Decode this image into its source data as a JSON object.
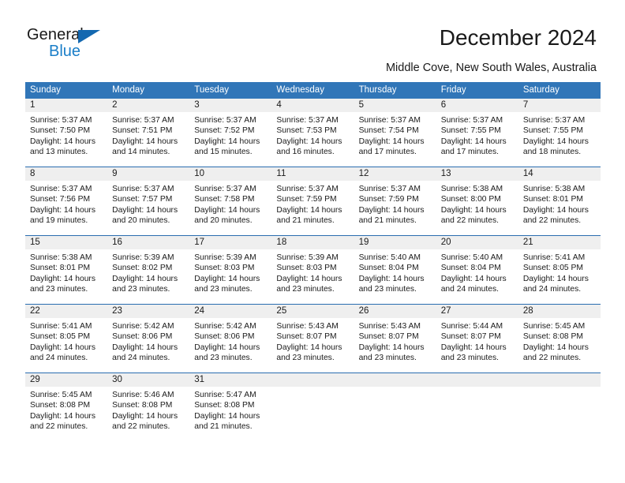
{
  "logo": {
    "word1": "General",
    "word2": "Blue",
    "triangle_color": "#1468b0",
    "blue_color": "#1a7ec8"
  },
  "header": {
    "title": "December 2024",
    "subtitle": "Middle Cove, New South Wales, Australia"
  },
  "theme": {
    "header_bg": "#3176b8",
    "week_divider": "#2a6db0",
    "day_band_bg": "#efefef",
    "text": "#1a1a1a"
  },
  "weekdays": [
    "Sunday",
    "Monday",
    "Tuesday",
    "Wednesday",
    "Thursday",
    "Friday",
    "Saturday"
  ],
  "labels": {
    "sunrise": "Sunrise:",
    "sunset": "Sunset:",
    "daylight": "Daylight:"
  },
  "weeks": [
    [
      {
        "day": "1",
        "sunrise": "Sunrise: 5:37 AM",
        "sunset": "Sunset: 7:50 PM",
        "daylight1": "Daylight: 14 hours",
        "daylight2": "and 13 minutes."
      },
      {
        "day": "2",
        "sunrise": "Sunrise: 5:37 AM",
        "sunset": "Sunset: 7:51 PM",
        "daylight1": "Daylight: 14 hours",
        "daylight2": "and 14 minutes."
      },
      {
        "day": "3",
        "sunrise": "Sunrise: 5:37 AM",
        "sunset": "Sunset: 7:52 PM",
        "daylight1": "Daylight: 14 hours",
        "daylight2": "and 15 minutes."
      },
      {
        "day": "4",
        "sunrise": "Sunrise: 5:37 AM",
        "sunset": "Sunset: 7:53 PM",
        "daylight1": "Daylight: 14 hours",
        "daylight2": "and 16 minutes."
      },
      {
        "day": "5",
        "sunrise": "Sunrise: 5:37 AM",
        "sunset": "Sunset: 7:54 PM",
        "daylight1": "Daylight: 14 hours",
        "daylight2": "and 17 minutes."
      },
      {
        "day": "6",
        "sunrise": "Sunrise: 5:37 AM",
        "sunset": "Sunset: 7:55 PM",
        "daylight1": "Daylight: 14 hours",
        "daylight2": "and 17 minutes."
      },
      {
        "day": "7",
        "sunrise": "Sunrise: 5:37 AM",
        "sunset": "Sunset: 7:55 PM",
        "daylight1": "Daylight: 14 hours",
        "daylight2": "and 18 minutes."
      }
    ],
    [
      {
        "day": "8",
        "sunrise": "Sunrise: 5:37 AM",
        "sunset": "Sunset: 7:56 PM",
        "daylight1": "Daylight: 14 hours",
        "daylight2": "and 19 minutes."
      },
      {
        "day": "9",
        "sunrise": "Sunrise: 5:37 AM",
        "sunset": "Sunset: 7:57 PM",
        "daylight1": "Daylight: 14 hours",
        "daylight2": "and 20 minutes."
      },
      {
        "day": "10",
        "sunrise": "Sunrise: 5:37 AM",
        "sunset": "Sunset: 7:58 PM",
        "daylight1": "Daylight: 14 hours",
        "daylight2": "and 20 minutes."
      },
      {
        "day": "11",
        "sunrise": "Sunrise: 5:37 AM",
        "sunset": "Sunset: 7:59 PM",
        "daylight1": "Daylight: 14 hours",
        "daylight2": "and 21 minutes."
      },
      {
        "day": "12",
        "sunrise": "Sunrise: 5:37 AM",
        "sunset": "Sunset: 7:59 PM",
        "daylight1": "Daylight: 14 hours",
        "daylight2": "and 21 minutes."
      },
      {
        "day": "13",
        "sunrise": "Sunrise: 5:38 AM",
        "sunset": "Sunset: 8:00 PM",
        "daylight1": "Daylight: 14 hours",
        "daylight2": "and 22 minutes."
      },
      {
        "day": "14",
        "sunrise": "Sunrise: 5:38 AM",
        "sunset": "Sunset: 8:01 PM",
        "daylight1": "Daylight: 14 hours",
        "daylight2": "and 22 minutes."
      }
    ],
    [
      {
        "day": "15",
        "sunrise": "Sunrise: 5:38 AM",
        "sunset": "Sunset: 8:01 PM",
        "daylight1": "Daylight: 14 hours",
        "daylight2": "and 23 minutes."
      },
      {
        "day": "16",
        "sunrise": "Sunrise: 5:39 AM",
        "sunset": "Sunset: 8:02 PM",
        "daylight1": "Daylight: 14 hours",
        "daylight2": "and 23 minutes."
      },
      {
        "day": "17",
        "sunrise": "Sunrise: 5:39 AM",
        "sunset": "Sunset: 8:03 PM",
        "daylight1": "Daylight: 14 hours",
        "daylight2": "and 23 minutes."
      },
      {
        "day": "18",
        "sunrise": "Sunrise: 5:39 AM",
        "sunset": "Sunset: 8:03 PM",
        "daylight1": "Daylight: 14 hours",
        "daylight2": "and 23 minutes."
      },
      {
        "day": "19",
        "sunrise": "Sunrise: 5:40 AM",
        "sunset": "Sunset: 8:04 PM",
        "daylight1": "Daylight: 14 hours",
        "daylight2": "and 23 minutes."
      },
      {
        "day": "20",
        "sunrise": "Sunrise: 5:40 AM",
        "sunset": "Sunset: 8:04 PM",
        "daylight1": "Daylight: 14 hours",
        "daylight2": "and 24 minutes."
      },
      {
        "day": "21",
        "sunrise": "Sunrise: 5:41 AM",
        "sunset": "Sunset: 8:05 PM",
        "daylight1": "Daylight: 14 hours",
        "daylight2": "and 24 minutes."
      }
    ],
    [
      {
        "day": "22",
        "sunrise": "Sunrise: 5:41 AM",
        "sunset": "Sunset: 8:05 PM",
        "daylight1": "Daylight: 14 hours",
        "daylight2": "and 24 minutes."
      },
      {
        "day": "23",
        "sunrise": "Sunrise: 5:42 AM",
        "sunset": "Sunset: 8:06 PM",
        "daylight1": "Daylight: 14 hours",
        "daylight2": "and 24 minutes."
      },
      {
        "day": "24",
        "sunrise": "Sunrise: 5:42 AM",
        "sunset": "Sunset: 8:06 PM",
        "daylight1": "Daylight: 14 hours",
        "daylight2": "and 23 minutes."
      },
      {
        "day": "25",
        "sunrise": "Sunrise: 5:43 AM",
        "sunset": "Sunset: 8:07 PM",
        "daylight1": "Daylight: 14 hours",
        "daylight2": "and 23 minutes."
      },
      {
        "day": "26",
        "sunrise": "Sunrise: 5:43 AM",
        "sunset": "Sunset: 8:07 PM",
        "daylight1": "Daylight: 14 hours",
        "daylight2": "and 23 minutes."
      },
      {
        "day": "27",
        "sunrise": "Sunrise: 5:44 AM",
        "sunset": "Sunset: 8:07 PM",
        "daylight1": "Daylight: 14 hours",
        "daylight2": "and 23 minutes."
      },
      {
        "day": "28",
        "sunrise": "Sunrise: 5:45 AM",
        "sunset": "Sunset: 8:08 PM",
        "daylight1": "Daylight: 14 hours",
        "daylight2": "and 22 minutes."
      }
    ],
    [
      {
        "day": "29",
        "sunrise": "Sunrise: 5:45 AM",
        "sunset": "Sunset: 8:08 PM",
        "daylight1": "Daylight: 14 hours",
        "daylight2": "and 22 minutes."
      },
      {
        "day": "30",
        "sunrise": "Sunrise: 5:46 AM",
        "sunset": "Sunset: 8:08 PM",
        "daylight1": "Daylight: 14 hours",
        "daylight2": "and 22 minutes."
      },
      {
        "day": "31",
        "sunrise": "Sunrise: 5:47 AM",
        "sunset": "Sunset: 8:08 PM",
        "daylight1": "Daylight: 14 hours",
        "daylight2": "and 21 minutes."
      },
      {
        "day": "",
        "sunrise": "",
        "sunset": "",
        "daylight1": "",
        "daylight2": ""
      },
      {
        "day": "",
        "sunrise": "",
        "sunset": "",
        "daylight1": "",
        "daylight2": ""
      },
      {
        "day": "",
        "sunrise": "",
        "sunset": "",
        "daylight1": "",
        "daylight2": ""
      },
      {
        "day": "",
        "sunrise": "",
        "sunset": "",
        "daylight1": "",
        "daylight2": ""
      }
    ]
  ]
}
